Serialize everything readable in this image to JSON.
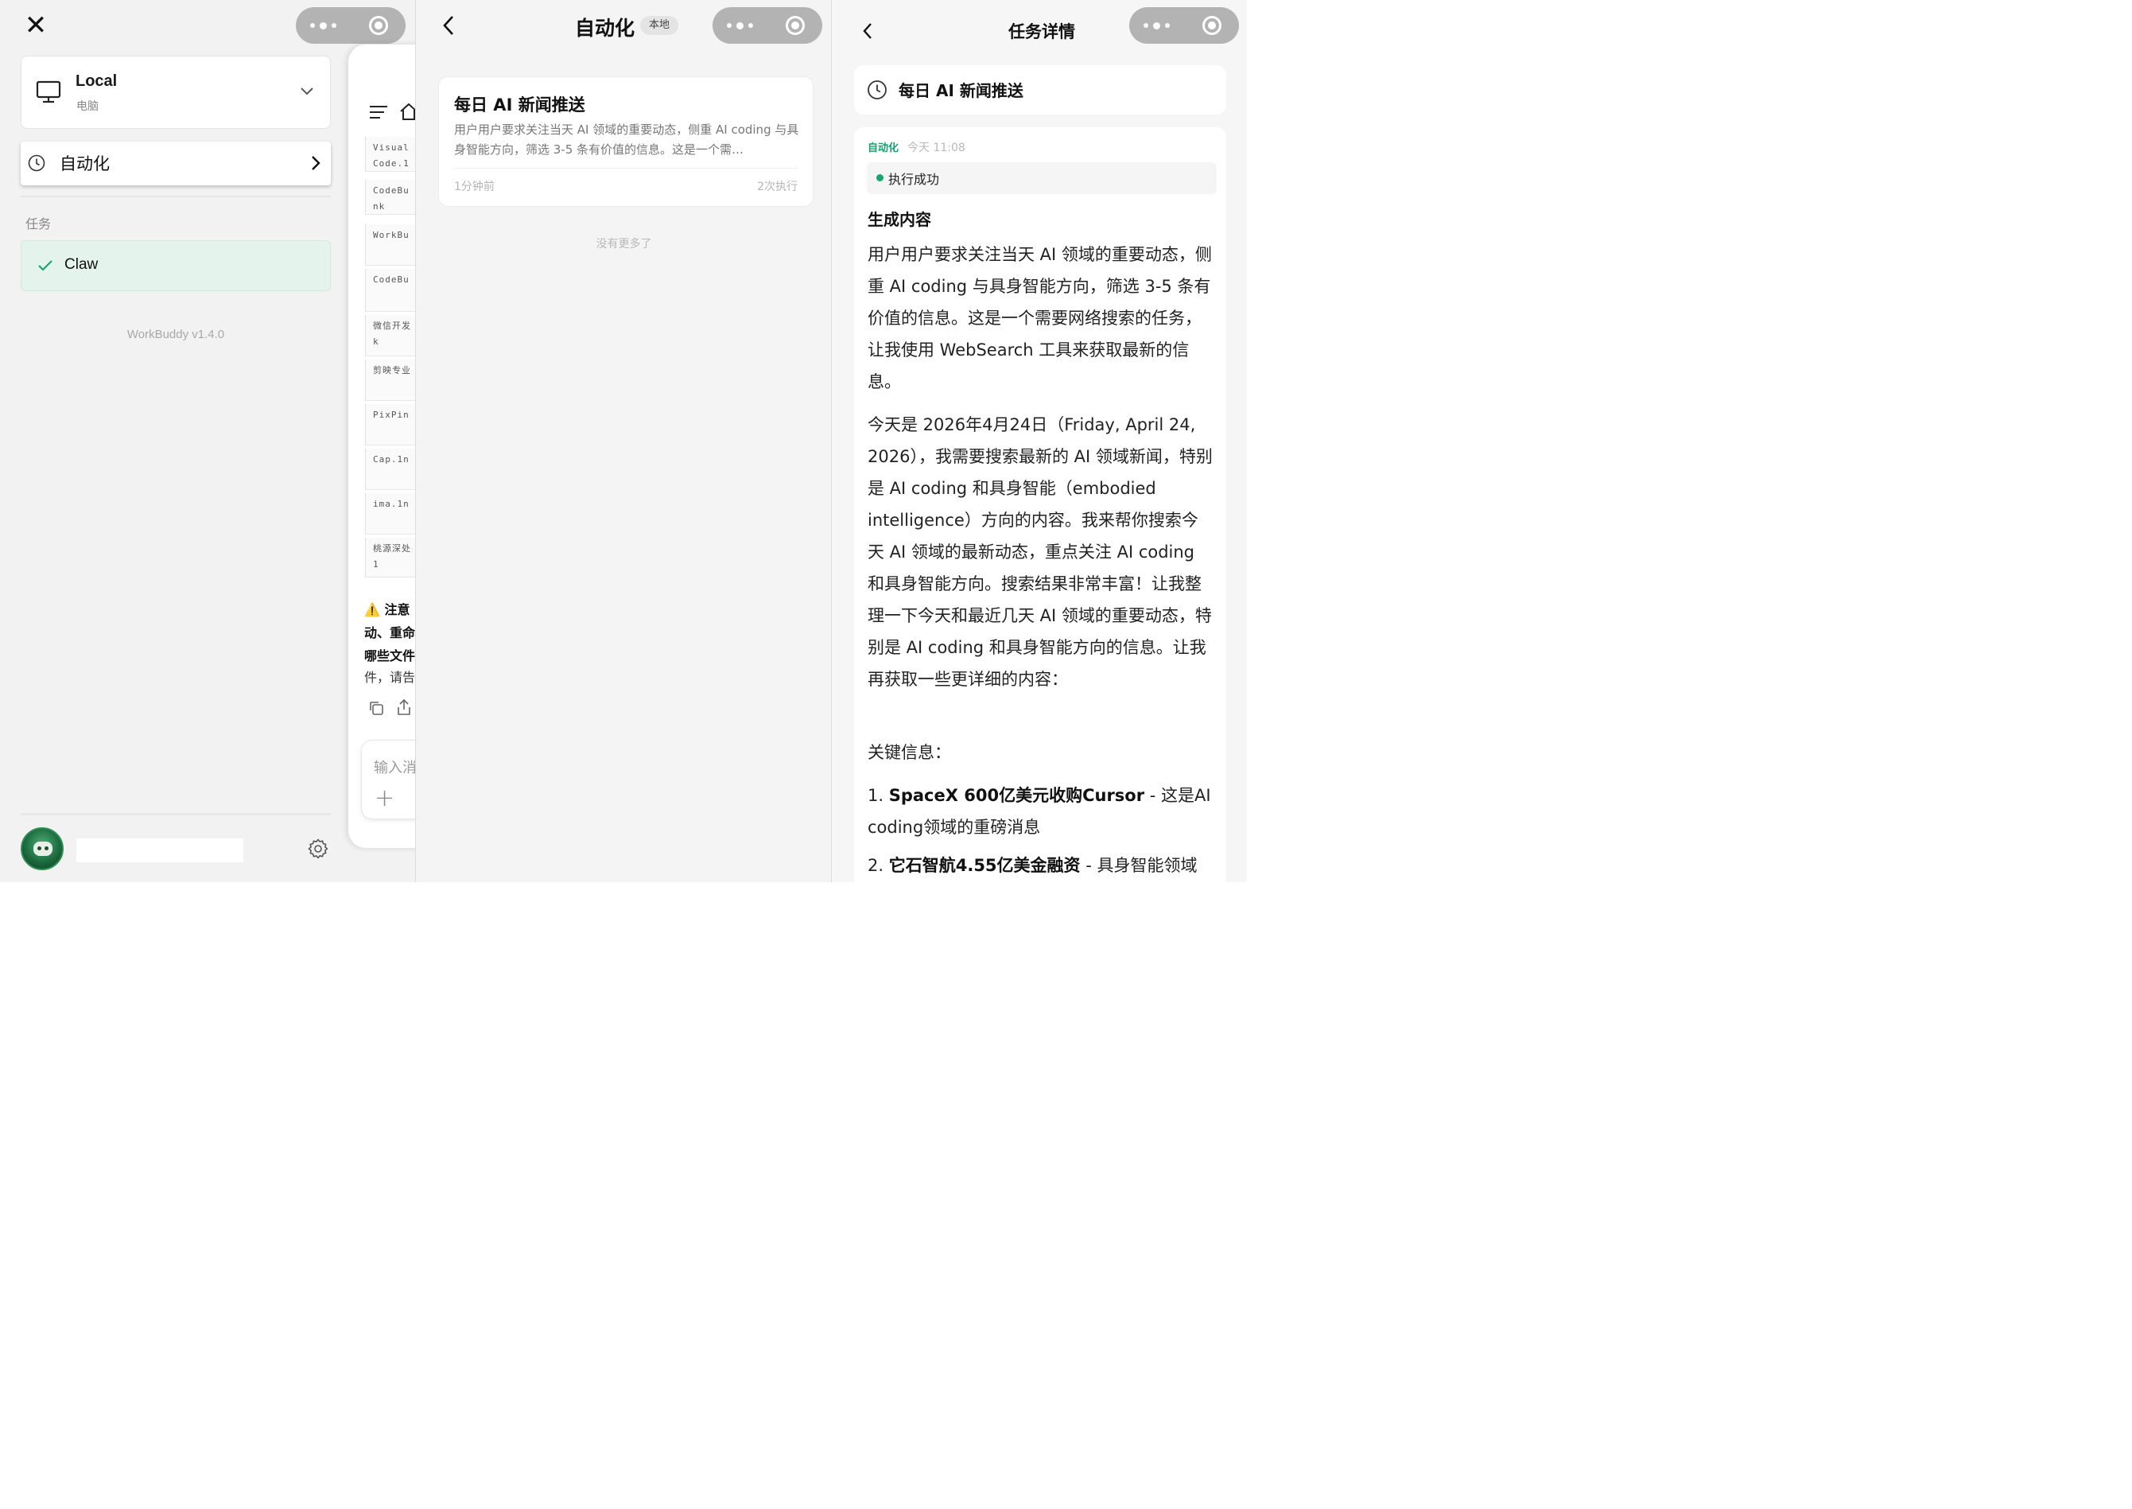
{
  "left_panel": {
    "close_icon": "close-icon",
    "workspace": {
      "name": "Local",
      "subtitle": "电脑"
    },
    "automation_label": "自动化",
    "tasks_label": "任务",
    "task_item": "Claw",
    "version": "WorkBuddy v1.4.0"
  },
  "chat_window": {
    "files": [
      [
        "Visual",
        "Code.1"
      ],
      [
        "CodeBu",
        "nk"
      ],
      [
        "WorkBu",
        ""
      ],
      [
        "CodeBu",
        ""
      ],
      [
        "微信开发",
        "k"
      ],
      [
        "剪映专业",
        ""
      ],
      [
        "PixPin",
        ""
      ],
      [
        "Cap.1n",
        ""
      ],
      [
        "ima.1n",
        ""
      ],
      [
        "桃源深处",
        "1"
      ]
    ],
    "warning_lines": [
      "⚠️ 注意",
      "动、重命",
      "哪些文件"
    ],
    "warning_tail": "件，请告",
    "input_placeholder": "输入消"
  },
  "middle_panel": {
    "title": "自动化",
    "badge": "本地",
    "card": {
      "title": "每日 AI 新闻推送",
      "description": "用户用户要求关注当天 AI 领域的重要动态，侧重 AI coding 与具身智能方向，筛选 3-5 条有价值的信息。这是一个需…",
      "time_ago": "1分钟前",
      "runs": "2次执行"
    },
    "no_more": "没有更多了"
  },
  "right_panel": {
    "title": "任务详情",
    "task_name": "每日 AI 新闻推送",
    "tag": "自动化",
    "timestamp": "今天 11:08",
    "status": "执行成功",
    "section_title": "生成内容",
    "paragraph1": "用户用户要求关注当天 AI 领域的重要动态，侧重 AI coding 与具身智能方向，筛选 3-5 条有价值的信息。这是一个需要网络搜索的任务，让我使用 WebSearch 工具来获取最新的信息。",
    "paragraph2": "今天是 2026年4月24日（Friday, April 24, 2026），我需要搜索最新的 AI 领域新闻，特别是 AI coding 和具身智能（embodied intelligence）方向的内容。我来帮你搜索今天 AI 领域的最新动态，重点关注 AI coding 和具身智能方向。搜索结果非常丰富！让我整理一下今天和最近几天 AI 领域的重要动态，特别是 AI coding 和具身智能方向的信息。让我再获取一些更详细的内容：",
    "key_info_label": "关键信息：",
    "items": [
      {
        "num": "1.",
        "headline": "SpaceX 600亿美元收购Cursor",
        "rest": " - 这是AI coding领域的重磅消息"
      },
      {
        "num": "2.",
        "headline": "它石智航4.55亿美金融资",
        "rest": " - 具身智能领域"
      }
    ]
  }
}
